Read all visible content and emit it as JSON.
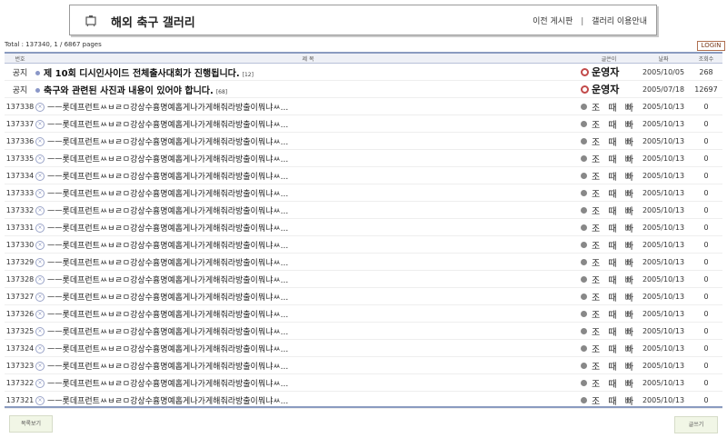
{
  "header": {
    "title": "해외 축구 갤러리",
    "links": [
      "이전 게시판",
      "갤러리 이용안내"
    ]
  },
  "total_line": "Total : 137340, 1 / 6867 pages",
  "login_label": "LOGIN",
  "columns": [
    "번호",
    "제 목",
    "글쓴이",
    "날짜",
    "조회수"
  ],
  "notices": [
    {
      "num": "공지",
      "title": "제 10회 디시인사이드 전체출사대회가 진행됩니다.",
      "comments": "[12]",
      "author": "운영자",
      "date": "2005/10/05",
      "views": "268"
    },
    {
      "num": "공지",
      "title": "축구와 관련된 사진과 내용이 있어야 합니다.",
      "comments": "[68]",
      "author": "운영자",
      "date": "2005/07/18",
      "views": "12697"
    }
  ],
  "posts": [
    {
      "num": "137338",
      "title": "ㅡㅡ롯데프런트ㅆㅂㄹㅁ강상수흉명예홉게나가게해줘라방출이뭐냐ㅆ...",
      "author": "조 때 빠",
      "date": "2005/10/13",
      "views": "0"
    },
    {
      "num": "137337",
      "title": "ㅡㅡ롯데프런트ㅆㅂㄹㅁ강상수흉명예홉게나가게해줘라방출이뭐냐ㅆ...",
      "author": "조 때 빠",
      "date": "2005/10/13",
      "views": "0"
    },
    {
      "num": "137336",
      "title": "ㅡㅡ롯데프런트ㅆㅂㄹㅁ강상수흉명예홉게나가게해줘라방출이뭐냐ㅆ...",
      "author": "조 때 빠",
      "date": "2005/10/13",
      "views": "0"
    },
    {
      "num": "137335",
      "title": "ㅡㅡ롯데프런트ㅆㅂㄹㅁ강상수흉명예홉게나가게해줘라방출이뭐냐ㅆ...",
      "author": "조 때 빠",
      "date": "2005/10/13",
      "views": "0"
    },
    {
      "num": "137334",
      "title": "ㅡㅡ롯데프런트ㅆㅂㄹㅁ강상수흉명예홉게나가게해줘라방출이뭐냐ㅆ...",
      "author": "조 때 빠",
      "date": "2005/10/13",
      "views": "0"
    },
    {
      "num": "137333",
      "title": "ㅡㅡ롯데프런트ㅆㅂㄹㅁ강상수흉명예홉게나가게해줘라방출이뭐냐ㅆ...",
      "author": "조 때 빠",
      "date": "2005/10/13",
      "views": "0"
    },
    {
      "num": "137332",
      "title": "ㅡㅡ롯데프런트ㅆㅂㄹㅁ강상수흉명예홉게나가게해줘라방출이뭐냐ㅆ...",
      "author": "조 때 빠",
      "date": "2005/10/13",
      "views": "0"
    },
    {
      "num": "137331",
      "title": "ㅡㅡ롯데프런트ㅆㅂㄹㅁ강상수흉명예홉게나가게해줘라방출이뭐냐ㅆ...",
      "author": "조 때 빠",
      "date": "2005/10/13",
      "views": "0"
    },
    {
      "num": "137330",
      "title": "ㅡㅡ롯데프런트ㅆㅂㄹㅁ강상수흉명예홉게나가게해줘라방출이뭐냐ㅆ...",
      "author": "조 때 빠",
      "date": "2005/10/13",
      "views": "0"
    },
    {
      "num": "137329",
      "title": "ㅡㅡ롯데프런트ㅆㅂㄹㅁ강상수흉명예홉게나가게해줘라방출이뭐냐ㅆ...",
      "author": "조 때 빠",
      "date": "2005/10/13",
      "views": "0"
    },
    {
      "num": "137328",
      "title": "ㅡㅡ롯데프런트ㅆㅂㄹㅁ강상수흉명예홉게나가게해줘라방출이뭐냐ㅆ...",
      "author": "조 때 빠",
      "date": "2005/10/13",
      "views": "0"
    },
    {
      "num": "137327",
      "title": "ㅡㅡ롯데프런트ㅆㅂㄹㅁ강상수흉명예홉게나가게해줘라방출이뭐냐ㅆ...",
      "author": "조 때 빠",
      "date": "2005/10/13",
      "views": "0"
    },
    {
      "num": "137326",
      "title": "ㅡㅡ롯데프런트ㅆㅂㄹㅁ강상수흉명예홉게나가게해줘라방출이뭐냐ㅆ...",
      "author": "조 때 빠",
      "date": "2005/10/13",
      "views": "0"
    },
    {
      "num": "137325",
      "title": "ㅡㅡ롯데프런트ㅆㅂㄹㅁ강상수흉명예홉게나가게해줘라방출이뭐냐ㅆ...",
      "author": "조 때 빠",
      "date": "2005/10/13",
      "views": "0"
    },
    {
      "num": "137324",
      "title": "ㅡㅡ롯데프런트ㅆㅂㄹㅁ강상수흉명예홉게나가게해줘라방출이뭐냐ㅆ...",
      "author": "조 때 빠",
      "date": "2005/10/13",
      "views": "0"
    },
    {
      "num": "137323",
      "title": "ㅡㅡ롯데프런트ㅆㅂㄹㅁ강상수흉명예홉게나가게해줘라방출이뭐냐ㅆ...",
      "author": "조 때 빠",
      "date": "2005/10/13",
      "views": "0"
    },
    {
      "num": "137322",
      "title": "ㅡㅡ롯데프런트ㅆㅂㄹㅁ강상수흉명예홉게나가게해줘라방출이뭐냐ㅆ...",
      "author": "조 때 빠",
      "date": "2005/10/13",
      "views": "0"
    },
    {
      "num": "137321",
      "title": "ㅡㅡ롯데프런트ㅆㅂㄹㅁ강상수흉명예홉게나가게해줘라방출이뭐냐ㅆ...",
      "author": "조 때 빠",
      "date": "2005/10/13",
      "views": "0"
    }
  ],
  "buttons": {
    "list": "목록보기",
    "write": "글쓰기"
  },
  "icons": {
    "gallery": "gallery-camera-icon",
    "notice": "pin-icon",
    "post": "reply-icon",
    "admin": "admin-icon",
    "user": "user-icon"
  },
  "colors": {
    "table_rule": "#8a9bc0",
    "header_bg": "#eef0f6",
    "button_bg": "#f1f6e6",
    "admin_icon": "#c24a4a"
  }
}
